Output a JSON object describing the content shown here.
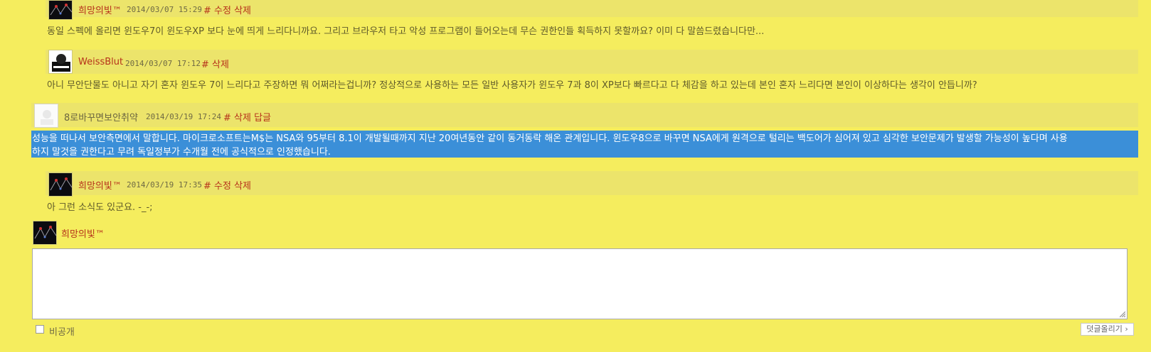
{
  "comments": [
    {
      "author": "희망의빛™",
      "date": "2014/03/07 15:29",
      "actions": [
        "# 수정",
        "삭제"
      ],
      "body": "동일 스펙에 올리면 윈도우7이 윈도우XP 보다 눈에 띄게 느리다니까요. 그리고 브라우저 타고 악성 프로그램이 들어오는데 무슨 권한인들 획득하지 못할까요? 이미 다 말씀드렸습니다만..."
    },
    {
      "author": "WeissBlut",
      "date": "2014/03/07 17:12",
      "actions": [
        "# 삭제"
      ],
      "body": "아니 무안단물도 아니고 자기 혼자 윈도우 7이 느리다고 주장하면 뭐 어쩌라는겁니까? 정상적으로 사용하는 모든 일반 사용자가 윈도우 7과 8이 XP보다 빠르다고 다 체감을 하고 있는데 본인 혼자 느리다면 본인이 이상하다는 생각이 안듭니까?"
    },
    {
      "author": "8로바꾸면보안취약",
      "date": "2014/03/19 17:24",
      "actions": [
        "# 삭제",
        "답글"
      ],
      "body_lines": [
        "성능을 떠나서 보안측면에서 말합니다. 마이크로소프트는M$는 NSA와 95부터 8.1이 개발될때까지 지난 20여년동안 같이 동거동락 해온 관계입니다. 윈도우8으로 바꾸면 NSA에게 원격으로 털리는 백도어가 심어져 있고 심각한 보안문제가 발생할 가능성이 높다며 사용",
        "하지 말것을 권한다고 무려 독일정부가 수개월 전에 공식적으로 인정했습니다."
      ]
    },
    {
      "author": "희망의빛™",
      "date": "2014/03/19 17:35",
      "actions": [
        "# 수정",
        "삭제"
      ],
      "body": "아 그런 소식도 있군요. -_-;"
    }
  ],
  "reply_form": {
    "author": "희망의빛™",
    "textarea_value": "",
    "private_label": "비공개",
    "submit_label": "덧글올리기 ›"
  },
  "colors": {
    "background": "#f5ed5e",
    "header_band": "#ece46b",
    "author_link": "#b6321b",
    "selection": "#3b8fd8"
  },
  "icons": {
    "avatar_dark": "avatar-icon",
    "avatar_light": "avatar-icon",
    "resize": "resize-grip-icon"
  }
}
